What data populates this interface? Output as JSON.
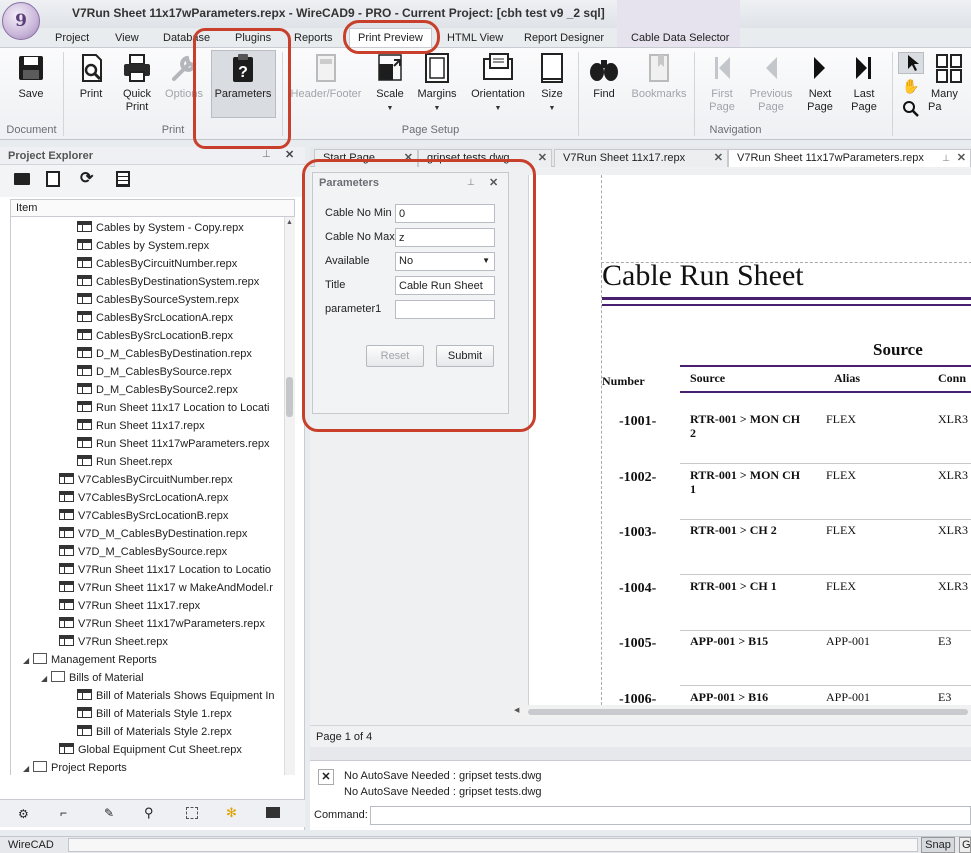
{
  "window": {
    "title": "V7Run Sheet 11x17wParameters.repx - WireCAD9 - PRO - Current Project: [cbh test v9 _2 sql]",
    "logo_text": "9"
  },
  "ribbon_tabs": [
    "Project",
    "View",
    "Database",
    "Plugins",
    "Reports",
    "Print Preview",
    "HTML View",
    "Report Designer",
    "Cable Data Selector"
  ],
  "ribbon": {
    "save": "Save",
    "print": "Print",
    "quick_print": [
      "Quick",
      "Print"
    ],
    "options": "Options",
    "parameters": "Parameters",
    "header_footer": "Header/Footer",
    "scale": "Scale",
    "margins": "Margins",
    "orientation": "Orientation",
    "size": "Size",
    "find": "Find",
    "bookmarks": "Bookmarks",
    "first_page": [
      "First",
      "Page"
    ],
    "previous_page": [
      "Previous",
      "Page"
    ],
    "next_page": [
      "Next",
      "Page"
    ],
    "last_page": [
      "Last",
      "Page"
    ],
    "many_pages": "Many Pa",
    "groups": {
      "document": "Document",
      "print": "Print",
      "page_setup": "Page Setup",
      "navigation": "Navigation"
    }
  },
  "project_explorer": {
    "title": "Project Explorer",
    "column": "Item",
    "items": [
      {
        "label": "Cables by System - Copy.repx",
        "depth": 4,
        "type": "report"
      },
      {
        "label": "Cables by System.repx",
        "depth": 4,
        "type": "report"
      },
      {
        "label": "CablesByCircuitNumber.repx",
        "depth": 4,
        "type": "report"
      },
      {
        "label": "CablesByDestinationSystem.repx",
        "depth": 4,
        "type": "report"
      },
      {
        "label": "CablesBySourceSystem.repx",
        "depth": 4,
        "type": "report"
      },
      {
        "label": "CablesBySrcLocationA.repx",
        "depth": 4,
        "type": "report"
      },
      {
        "label": "CablesBySrcLocationB.repx",
        "depth": 4,
        "type": "report"
      },
      {
        "label": "D_M_CablesByDestination.repx",
        "depth": 4,
        "type": "report"
      },
      {
        "label": "D_M_CablesBySource.repx",
        "depth": 4,
        "type": "report"
      },
      {
        "label": "D_M_CablesBySource2.repx",
        "depth": 4,
        "type": "report"
      },
      {
        "label": "Run Sheet 11x17 Location to Locati",
        "depth": 4,
        "type": "report"
      },
      {
        "label": "Run Sheet 11x17.repx",
        "depth": 4,
        "type": "report"
      },
      {
        "label": "Run Sheet 11x17wParameters.repx",
        "depth": 4,
        "type": "report"
      },
      {
        "label": "Run Sheet.repx",
        "depth": 4,
        "type": "report"
      },
      {
        "label": "V7CablesByCircuitNumber.repx",
        "depth": 3,
        "type": "report"
      },
      {
        "label": "V7CablesBySrcLocationA.repx",
        "depth": 3,
        "type": "report"
      },
      {
        "label": "V7CablesBySrcLocationB.repx",
        "depth": 3,
        "type": "report"
      },
      {
        "label": "V7D_M_CablesByDestination.repx",
        "depth": 3,
        "type": "report"
      },
      {
        "label": "V7D_M_CablesBySource.repx",
        "depth": 3,
        "type": "report"
      },
      {
        "label": "V7Run Sheet 11x17 Location to Locatio",
        "depth": 3,
        "type": "report"
      },
      {
        "label": "V7Run Sheet 11x17 w MakeAndModel.r",
        "depth": 3,
        "type": "report"
      },
      {
        "label": "V7Run Sheet 11x17.repx",
        "depth": 3,
        "type": "report"
      },
      {
        "label": "V7Run Sheet 11x17wParameters.repx",
        "depth": 3,
        "type": "report"
      },
      {
        "label": "V7Run Sheet.repx",
        "depth": 3,
        "type": "report"
      },
      {
        "label": "Management Reports",
        "depth": 1,
        "type": "folder"
      },
      {
        "label": "Bills of Material",
        "depth": 2,
        "type": "folder"
      },
      {
        "label": "Bill of Materials Shows Equipment In",
        "depth": 4,
        "type": "report"
      },
      {
        "label": "Bill of Materials Style 1.repx",
        "depth": 4,
        "type": "report"
      },
      {
        "label": "Bill of Materials Style 2.repx",
        "depth": 4,
        "type": "report"
      },
      {
        "label": "Global Equipment Cut Sheet.repx",
        "depth": 3,
        "type": "report"
      },
      {
        "label": "Project Reports",
        "depth": 1,
        "type": "folder"
      }
    ]
  },
  "doc_tabs": [
    "Start Page",
    "gripset tests.dwg",
    "V7Run Sheet 11x17.repx",
    "V7Run Sheet 11x17wParameters.repx"
  ],
  "parameters_panel": {
    "title": "Parameters",
    "fields": [
      {
        "label": "Cable No Min",
        "value": "0"
      },
      {
        "label": "Cable No Max",
        "value": "z"
      },
      {
        "label": "Available",
        "value": "No"
      },
      {
        "label": "Title",
        "value": "Cable Run Sheet"
      },
      {
        "label": "parameter1",
        "value": ""
      }
    ],
    "reset": "Reset",
    "submit": "Submit"
  },
  "report": {
    "title": "Cable Run Sheet",
    "group_header": "Source",
    "columns": [
      "Number",
      "Source",
      "Alias",
      "Conn"
    ],
    "rows": [
      {
        "number": "-1001-",
        "source": [
          "RTR-001 > MON CH",
          "2"
        ],
        "alias": "FLEX",
        "conn": "XLR3"
      },
      {
        "number": "-1002-",
        "source": [
          "RTR-001 > MON CH",
          "1"
        ],
        "alias": "FLEX",
        "conn": "XLR3"
      },
      {
        "number": "-1003-",
        "source": [
          "RTR-001 > CH 2"
        ],
        "alias": "FLEX",
        "conn": "XLR3"
      },
      {
        "number": "-1004-",
        "source": [
          "RTR-001 > CH 1"
        ],
        "alias": "FLEX",
        "conn": "XLR3"
      },
      {
        "number": "-1005-",
        "source": [
          "APP-001 > B15"
        ],
        "alias": "APP-001",
        "conn": "E3"
      },
      {
        "number": "-1006-",
        "source": [
          "APP-001 > B16"
        ],
        "alias": "APP-001",
        "conn": "E3"
      }
    ]
  },
  "page_status": "Page 1 of 4",
  "output": {
    "lines": [
      "No AutoSave Needed : gripset tests.dwg",
      "No AutoSave Needed : gripset tests.dwg"
    ],
    "command_label": "Command:"
  },
  "status_bar": {
    "app": "WireCAD",
    "snap": "Snap",
    "extra": "G"
  },
  "colors": {
    "accent_ring": "#c8402c",
    "report_rule": "#4b1f6f"
  }
}
